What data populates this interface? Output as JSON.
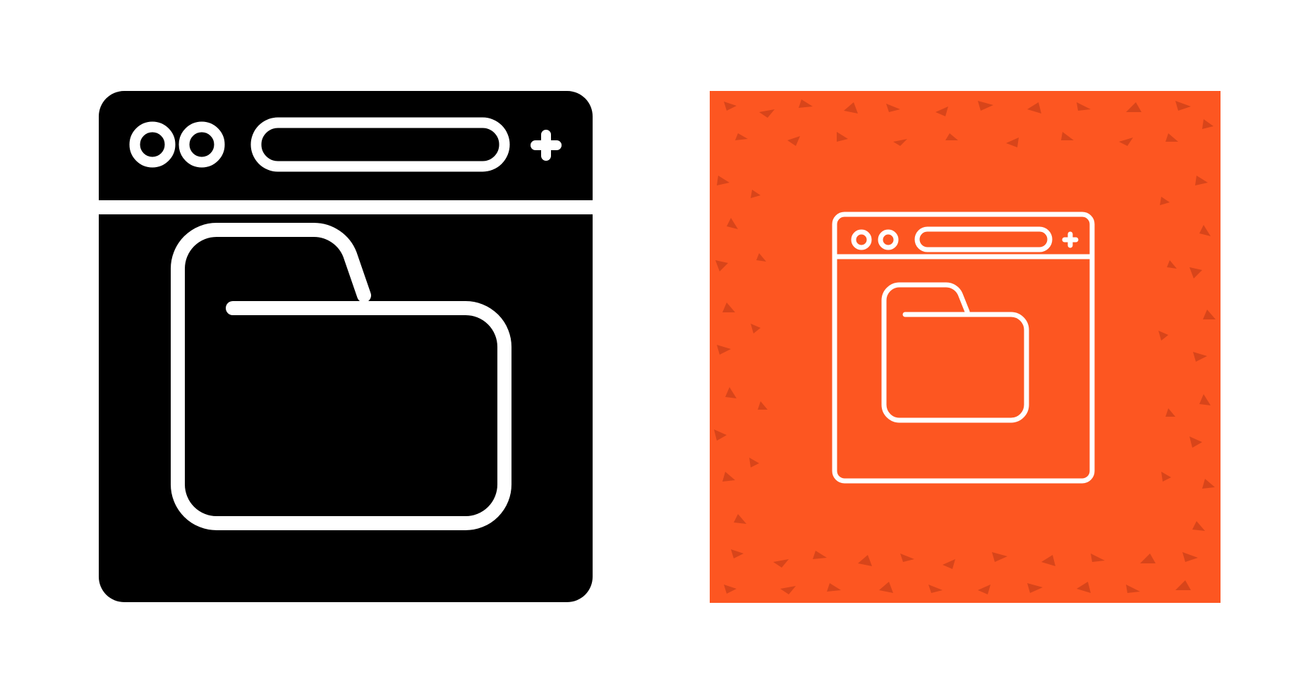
{
  "colors": {
    "background": "#ffffff",
    "glyph_fill": "#000000",
    "glyph_stroke": "#ffffff",
    "tile_orange": "#fd5621",
    "tile_speckle": "#d4441a",
    "outline_stroke": "#ffffff"
  },
  "icons": [
    {
      "name": "browser-folder-glyph-icon",
      "style": "solid"
    },
    {
      "name": "browser-folder-outline-icon",
      "style": "line-on-orange-tile"
    }
  ]
}
